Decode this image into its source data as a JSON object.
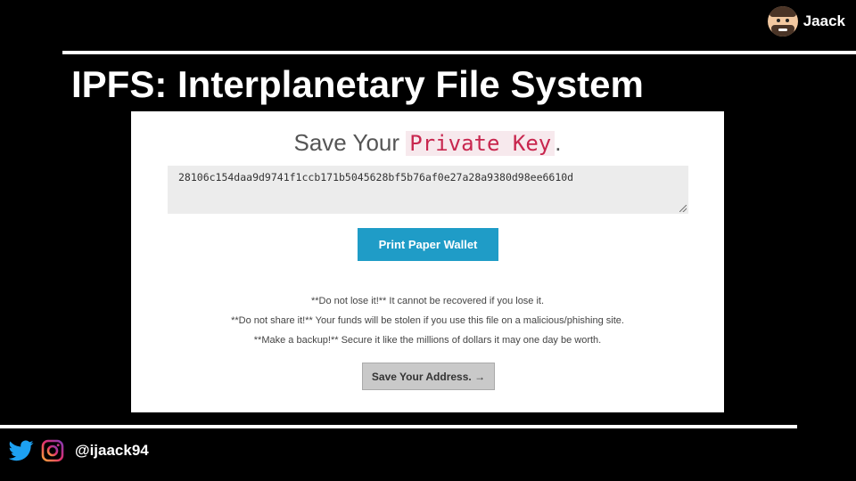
{
  "brand": {
    "name": "Jaack",
    "icon": "memoji-avatar-icon"
  },
  "title": "IPFS: Interplanetary File System",
  "screenshot": {
    "heading_prefix": "Save Your",
    "heading_highlight": "Private Key",
    "heading_suffix": ".",
    "private_key": "28106c154daa9d9741f1ccb171b5045628bf5b76af0e27a28a9380d98ee6610d",
    "print_button": "Print Paper Wallet",
    "warnings": [
      "**Do not lose it!** It cannot be recovered if you lose it.",
      "**Do not share it!** Your funds will be stolen if you use this file on a malicious/phishing site.",
      "**Make a backup!** Secure it like the millions of dollars it may one day be worth."
    ],
    "next_button": "Save Your Address. →",
    "colors": {
      "highlight_text": "#c8264e",
      "print_button": "#1f9cc7",
      "next_button": "#c9c9c9"
    }
  },
  "social": {
    "icons": [
      "twitter-icon",
      "instagram-icon"
    ],
    "handle": "@ijaack94",
    "colors": {
      "twitter": "#1da1f2"
    }
  }
}
